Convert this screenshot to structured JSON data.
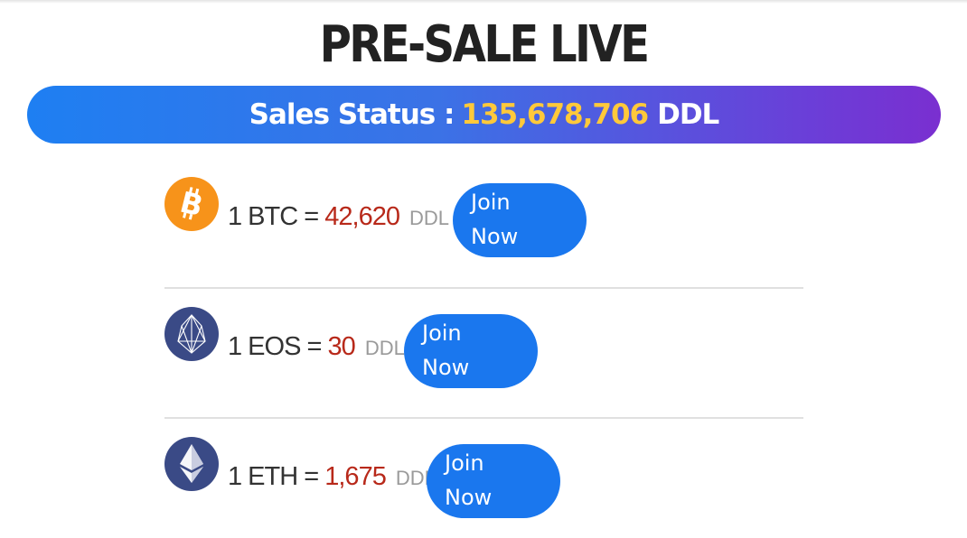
{
  "title": "PRE-SALE LIVE",
  "sales_status": {
    "label": "Sales Status :",
    "amount": "135,678,706",
    "unit": "DDL",
    "gradient_start": "#1e7ff2",
    "gradient_end": "#7a2fd0",
    "amount_color": "#ffc93a"
  },
  "rates": [
    {
      "icon": "bitcoin-icon",
      "prefix": "1 BTC =",
      "value": "42,620",
      "unit": "DDL",
      "button_line1": "Join",
      "button_line2": "Now",
      "icon_color": "#f7931a"
    },
    {
      "icon": "eos-icon",
      "prefix": "1 EOS =",
      "value": "30",
      "unit": "DDL",
      "button_line1": "Join",
      "button_line2": "Now",
      "icon_color": "#3a4a86"
    },
    {
      "icon": "ethereum-icon",
      "prefix": "1 ETH =",
      "value": "1,675",
      "unit": "DDL",
      "button_line1": "Join",
      "button_line2": "Now",
      "icon_color": "#3a4a86"
    }
  ],
  "colors": {
    "button": "#1a77ee",
    "value": "#b8291a",
    "unit": "#9a9a9a"
  }
}
